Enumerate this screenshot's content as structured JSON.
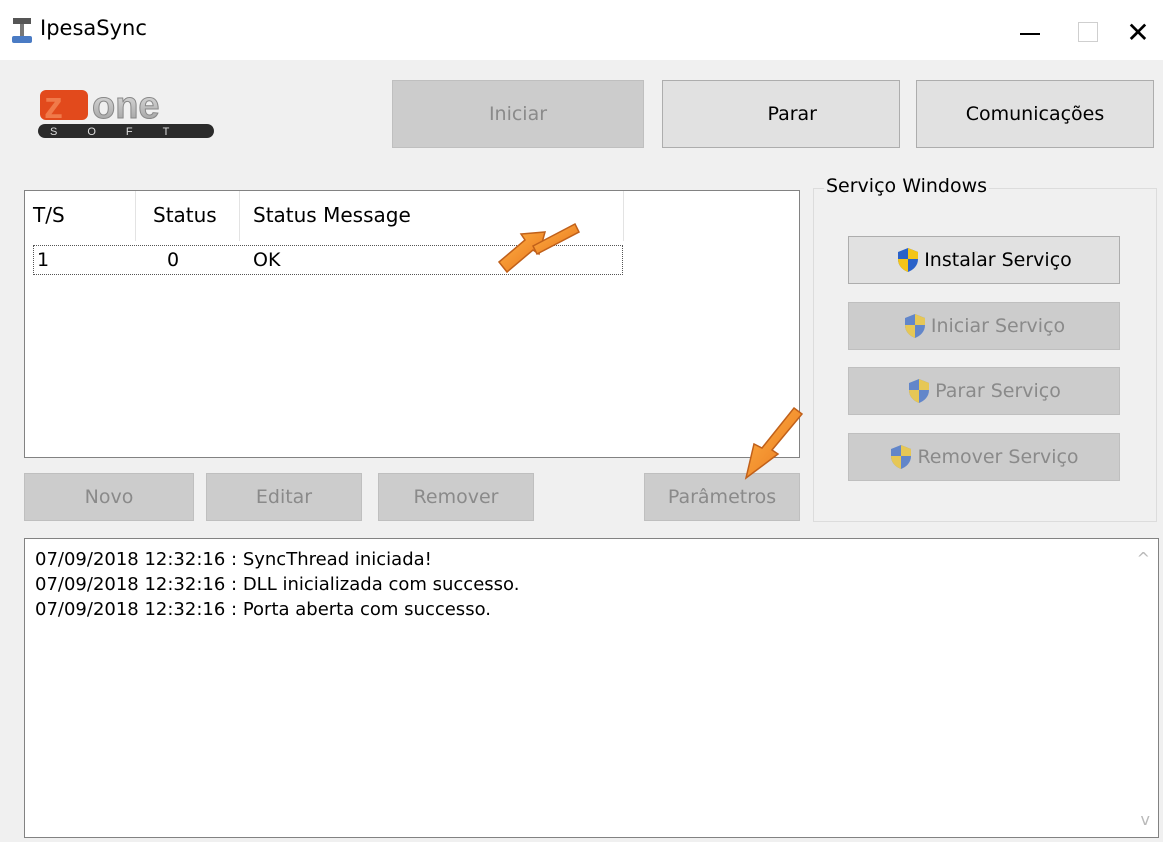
{
  "window": {
    "title": "IpesaSync",
    "controls": {
      "minimize": "—",
      "maximize": "□",
      "close": "✕"
    }
  },
  "logo": {
    "brand": "zone",
    "sub": "SOFT"
  },
  "toolbar": {
    "iniciar": "Iniciar",
    "parar": "Parar",
    "comunicacoes": "Comunicações"
  },
  "table": {
    "columns": [
      "T/S",
      "Status",
      "Status Message"
    ],
    "rows": [
      {
        "ts": "1",
        "status": "0",
        "message": "OK"
      }
    ]
  },
  "actions": {
    "novo": "Novo",
    "editar": "Editar",
    "remover": "Remover",
    "parametros": "Parâmetros"
  },
  "service_group": {
    "label": "Serviço Windows",
    "buttons": [
      "Instalar Serviço",
      "Iniciar Serviço",
      "Parar Serviço",
      "Remover Serviço"
    ]
  },
  "log": {
    "lines": [
      "07/09/2018 12:32:16 : SyncThread iniciada!",
      "07/09/2018 12:32:16 : DLL inicializada com successo.",
      "07/09/2018 12:32:16 : Porta aberta com successo."
    ]
  },
  "colors": {
    "window_bg": "#f0f0f0",
    "disabled_button": "#cccccc",
    "enabled_button": "#e1e1e1",
    "annotation_arrow": "#f28a1e",
    "shield_blue": "#2a62c9",
    "shield_yellow": "#f5c518"
  }
}
